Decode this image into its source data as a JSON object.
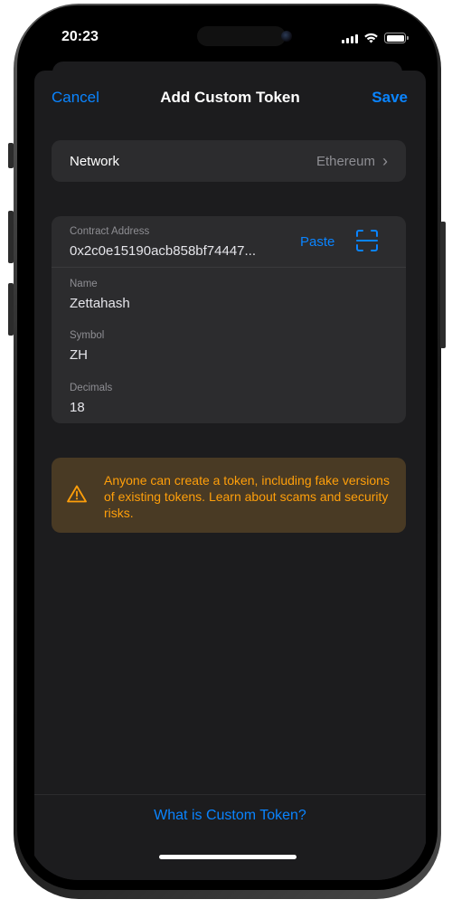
{
  "status_bar": {
    "time": "20:23",
    "icons": [
      "cellular-signal-icon",
      "wifi-icon",
      "battery-icon"
    ]
  },
  "nav": {
    "cancel_label": "Cancel",
    "title": "Add Custom Token",
    "save_label": "Save"
  },
  "network": {
    "label": "Network",
    "value": "Ethereum",
    "icon": "chevron-right-icon"
  },
  "fields": {
    "contract_address": {
      "label": "Contract Address",
      "value": "0x2c0e15190acb858bf74447...",
      "paste_label": "Paste",
      "scan_icon": "qr-scan-icon"
    },
    "name": {
      "label": "Name",
      "value": "Zettahash"
    },
    "symbol": {
      "label": "Symbol",
      "value": "ZH"
    },
    "decimals": {
      "label": "Decimals",
      "value": "18"
    }
  },
  "warning": {
    "icon": "warning-triangle-icon",
    "text": "Anyone can create a token, including fake versions of existing tokens. Learn about scams and security risks."
  },
  "footer": {
    "link_label": "What is Custom Token?"
  },
  "colors": {
    "accent": "#0a84ff",
    "sheet_bg": "#1c1c1e",
    "card_bg": "#2c2c2e",
    "warning_bg": "#493a24",
    "warning_text": "#ff9f0a"
  }
}
